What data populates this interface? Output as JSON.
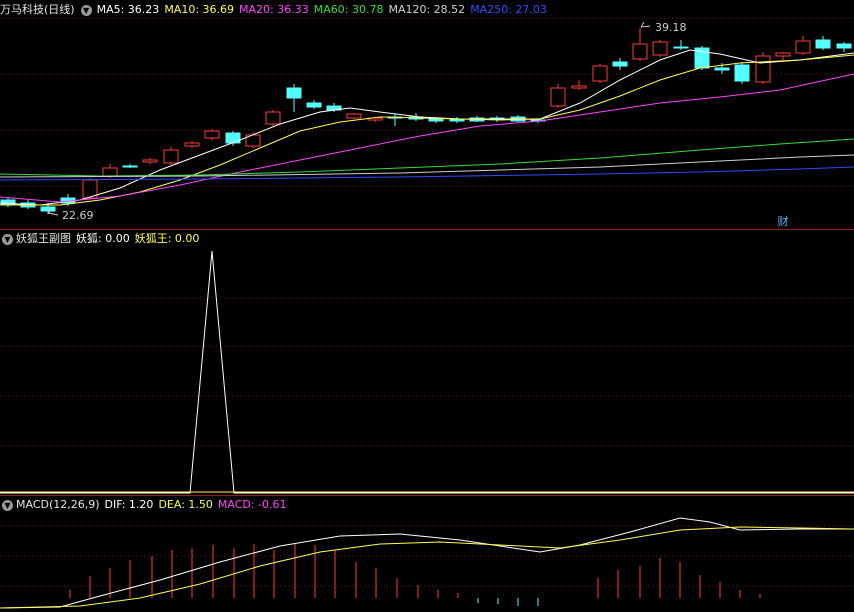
{
  "main": {
    "title": "万马科技(日线)",
    "ma_labels": [
      {
        "text": "MA5: 36.23",
        "color": "#ffffff"
      },
      {
        "text": "MA10: 36.69",
        "color": "#ffff4d"
      },
      {
        "text": "MA20: 36.33",
        "color": "#ff44ff"
      },
      {
        "text": "MA60: 30.78",
        "color": "#33dd33"
      },
      {
        "text": "MA120: 28.52",
        "color": "#d0d0d0"
      },
      {
        "text": "MA250: 27.03",
        "color": "#2c4bff"
      }
    ],
    "high_label": "39.18",
    "low_label": "22.69",
    "fin_badge": "财"
  },
  "sub1": {
    "title": "妖狐王副图",
    "labels": [
      {
        "text": "妖狐: 0.00",
        "color": "#ffffff"
      },
      {
        "text": "妖狐王: 0.00",
        "color": "#ffff4d"
      }
    ]
  },
  "macd": {
    "title": "MACD(12,26,9)",
    "labels": [
      {
        "text": "DIF: 1.20",
        "color": "#ffffff"
      },
      {
        "text": "DEA: 1.50",
        "color": "#ffff4d"
      },
      {
        "text": "MACD: -0.61",
        "color": "#ff44ff"
      }
    ]
  },
  "colors": {
    "up": "#ff3b3b",
    "down": "#54ffff",
    "grid": "#7a1414"
  }
}
